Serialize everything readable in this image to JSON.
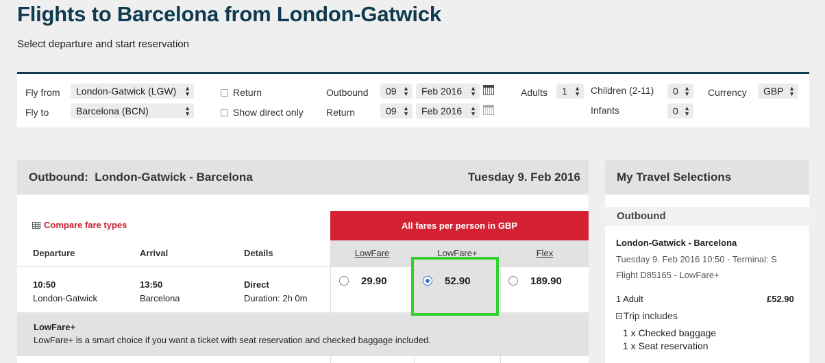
{
  "page": {
    "title": "Flights to Barcelona from London-Gatwick",
    "subtitle": "Select departure and start reservation"
  },
  "search": {
    "fly_from_label": "Fly from",
    "fly_from_value": "London-Gatwick (LGW)",
    "fly_to_label": "Fly to",
    "fly_to_value": "Barcelona (BCN)",
    "return_label": "Return",
    "direct_label": "Show direct only",
    "outbound_label": "Outbound",
    "outbound_day": "09",
    "outbound_month": "Feb 2016",
    "return_date_label": "Return",
    "return_day": "09",
    "return_month": "Feb 2016",
    "adults_label": "Adults",
    "adults_value": "1",
    "children_label": "Children (2-11)",
    "children_value": "0",
    "infants_label": "Infants",
    "infants_value": "0",
    "currency_label": "Currency",
    "currency_value": "GBP"
  },
  "outbound": {
    "heading": "Outbound:  London-Gatwick - Barcelona",
    "date": "Tuesday 9. Feb 2016",
    "compare_link": "Compare fare types",
    "fares_banner": "All fares per person in GBP",
    "columns": {
      "departure": "Departure",
      "arrival": "Arrival",
      "details": "Details"
    },
    "fare_types": [
      "LowFare",
      "LowFare+",
      "Flex"
    ],
    "flight": {
      "dep_time": "10:50",
      "dep_place": "London-Gatwick",
      "arr_time": "13:50",
      "arr_place": "Barcelona",
      "type": "Direct",
      "duration": "Duration: 2h 0m",
      "prices": [
        "29.90",
        "52.90",
        "189.90"
      ],
      "selected_fare": "LowFare+"
    },
    "info": {
      "title": "LowFare+",
      "description": "LowFare+ is a smart choice if you want a ticket with seat reservation and checked baggage included."
    }
  },
  "selections": {
    "heading": "My Travel Selections",
    "section": "Outbound",
    "route": "London-Gatwick - Barcelona",
    "datetime": "Tuesday 9. Feb 2016 10:50 - Terminal: S",
    "flight": "Flight D85165 - LowFare+",
    "pax": "1 Adult",
    "total": "£52.90",
    "trip_includes": "Trip includes",
    "includes": [
      "1 x Checked baggage",
      "1 x Seat reservation"
    ]
  },
  "colors": {
    "title": "#0f3a4f",
    "accent_red": "#d42133",
    "highlight_green": "#2fd22a",
    "radio_selected": "#2a7ad4"
  }
}
